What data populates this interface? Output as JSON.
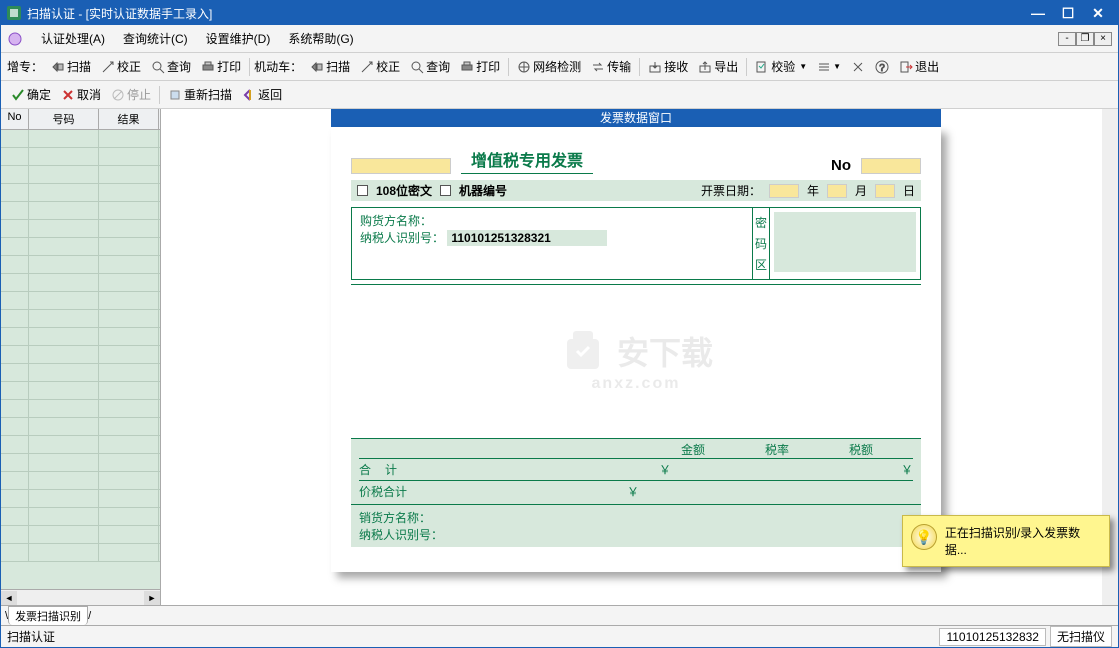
{
  "title": "扫描认证 - [实时认证数据手工录入]",
  "menus": {
    "m1": "认证处理(A)",
    "m2": "查询统计(C)",
    "m3": "设置维护(D)",
    "m4": "系统帮助(G)"
  },
  "tb1": {
    "lbl": "增专：",
    "scan": "扫描",
    "adjust": "校正",
    "query": "查询",
    "print": "打印",
    "motor": "机动车：",
    "scan2": "扫描",
    "adjust2": "校正",
    "query2": "查询",
    "print2": "打印",
    "net": "网络检测",
    "trans": "传输",
    "recv": "接收",
    "export": "导出",
    "verify": "校验",
    "exit": "退出"
  },
  "tb2": {
    "ok": "确定",
    "cancel": "取消",
    "stop": "停止",
    "rescan": "重新扫描",
    "back": "返回"
  },
  "grid": {
    "no": "No",
    "num": "号码",
    "res": "结果"
  },
  "invoice": {
    "winTitle": "发票数据窗口",
    "fpTitle": "增值税专用发票",
    "noLabel": "No",
    "cipher108": "108位密文",
    "machineNo": "机器编号",
    "issueDate": "开票日期：",
    "year": "年",
    "month": "月",
    "day": "日",
    "buyerName": "购货方名称：",
    "taxIdLabel": "纳税人识别号：",
    "taxId": "110101251328321",
    "pwd1": "密",
    "pwd2": "码",
    "pwd3": "区",
    "amount": "金额",
    "rate": "税率",
    "tax": "税额",
    "sum": "合",
    "sum2": "计",
    "yen": "￥",
    "priceTax": "价税合计",
    "sellerName": "销货方名称：",
    "sellerTaxId": "纳税人识别号：",
    "wm1": "安下载",
    "wm2": "anxz.com"
  },
  "toast": "正在扫描识别/录入发票数据...",
  "tab": "发票扫描识别",
  "status": {
    "left": "扫描认证",
    "id": "11010125132832",
    "dev": "无扫描仪"
  }
}
